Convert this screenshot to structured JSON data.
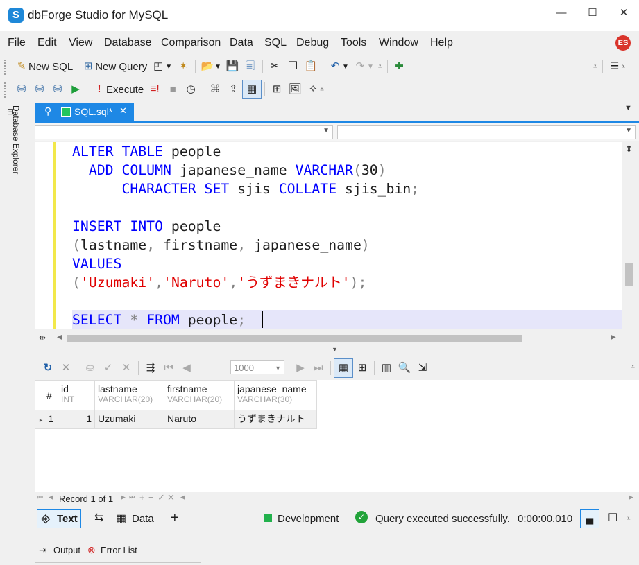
{
  "app": {
    "title": "dbForge Studio for MySQL",
    "logo_letter": "S",
    "user_initials": "ES"
  },
  "window_controls": {
    "minimize": "—",
    "maximize": "☐",
    "close": "✕"
  },
  "menu": [
    "File",
    "Edit",
    "View",
    "Database",
    "Comparison",
    "Data",
    "SQL",
    "Debug",
    "Tools",
    "Window",
    "Help"
  ],
  "toolbar1": {
    "new_sql": "New SQL",
    "new_query": "New Query"
  },
  "toolbar2": {
    "execute": "Execute"
  },
  "sidebar": {
    "database_explorer": "Database Explorer"
  },
  "document": {
    "tab_label": "SQL.sql*",
    "close": "✕"
  },
  "editor": {
    "lines": [
      [
        {
          "t": "ALTER TABLE ",
          "c": "kw"
        },
        {
          "t": "people",
          "c": "id"
        }
      ],
      [
        {
          "t": "  ADD COLUMN ",
          "c": "kw"
        },
        {
          "t": "japanese_name ",
          "c": "id"
        },
        {
          "t": "VARCHAR",
          "c": "kw"
        },
        {
          "t": "(",
          "c": "op"
        },
        {
          "t": "30",
          "c": "id"
        },
        {
          "t": ")",
          "c": "op"
        }
      ],
      [
        {
          "t": "      CHARACTER SET ",
          "c": "kw"
        },
        {
          "t": "sjis ",
          "c": "id"
        },
        {
          "t": "COLLATE ",
          "c": "kw"
        },
        {
          "t": "sjis_bin",
          "c": "id"
        },
        {
          "t": ";",
          "c": "op"
        }
      ],
      [],
      [
        {
          "t": "INSERT INTO ",
          "c": "kw"
        },
        {
          "t": "people",
          "c": "id"
        }
      ],
      [
        {
          "t": "(",
          "c": "op"
        },
        {
          "t": "lastname",
          "c": "id"
        },
        {
          "t": ", ",
          "c": "op"
        },
        {
          "t": "firstname",
          "c": "id"
        },
        {
          "t": ", ",
          "c": "op"
        },
        {
          "t": "japanese_name",
          "c": "id"
        },
        {
          "t": ")",
          "c": "op"
        }
      ],
      [
        {
          "t": "VALUES",
          "c": "kw"
        }
      ],
      [
        {
          "t": "(",
          "c": "op"
        },
        {
          "t": "'Uzumaki'",
          "c": "str"
        },
        {
          "t": ",",
          "c": "op"
        },
        {
          "t": "'Naruto'",
          "c": "str"
        },
        {
          "t": ",",
          "c": "op"
        },
        {
          "t": "'うずまきナルト'",
          "c": "str"
        },
        {
          "t": ");",
          "c": "op"
        }
      ],
      [],
      [
        {
          "t": "SELECT ",
          "c": "kw"
        },
        {
          "t": "* ",
          "c": "op"
        },
        {
          "t": "FROM ",
          "c": "kw"
        },
        {
          "t": "people",
          "c": "id"
        },
        {
          "t": ";",
          "c": "op"
        }
      ]
    ]
  },
  "results_toolbar": {
    "limit_value": "1000"
  },
  "grid": {
    "row_header": "#",
    "columns": [
      {
        "name": "id",
        "type": "INT"
      },
      {
        "name": "lastname",
        "type": "VARCHAR(20)"
      },
      {
        "name": "firstname",
        "type": "VARCHAR(20)"
      },
      {
        "name": "japanese_name",
        "type": "VARCHAR(30)"
      }
    ],
    "rows": [
      {
        "num": "1",
        "cells": [
          "1",
          "Uzumaki",
          "Naruto",
          "うずまきナルト"
        ]
      }
    ]
  },
  "record_bar": {
    "label": "Record 1 of 1"
  },
  "statusbar": {
    "text_tab": "Text",
    "data_tab": "Data",
    "add": "+",
    "environment": "Development",
    "env_color": "#22b14c",
    "message": "Query executed successfully.",
    "elapsed": "0:00:00.010"
  },
  "bottom": {
    "output": "Output",
    "error_list": "Error List"
  }
}
